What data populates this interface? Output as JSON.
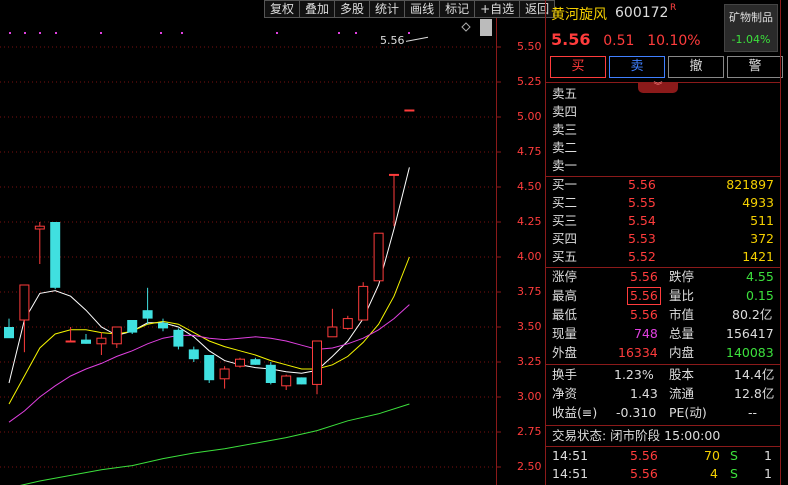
{
  "toolbar": [
    "复权",
    "叠加",
    "多股",
    "统计",
    "画线",
    "标记",
    "+自选",
    "返回"
  ],
  "stock": {
    "name": "黄河旋风",
    "code": "600172",
    "badge": "R",
    "price": "5.56",
    "change": "0.51",
    "pct": "10.10%",
    "sector_name": "矿物制品",
    "sector_chg": "-1.04%"
  },
  "buttons": {
    "buy": "买",
    "sell": "卖",
    "cancel": "撤",
    "alert": "警"
  },
  "expand_icon": "double-chevron-down",
  "sell_orders": [
    {
      "label": "卖五"
    },
    {
      "label": "卖四"
    },
    {
      "label": "卖三"
    },
    {
      "label": "卖二"
    },
    {
      "label": "卖一"
    }
  ],
  "buy_orders": [
    {
      "label": "买一",
      "price": "5.56",
      "vol": "821897"
    },
    {
      "label": "买二",
      "price": "5.55",
      "vol": "4933"
    },
    {
      "label": "买三",
      "price": "5.54",
      "vol": "511"
    },
    {
      "label": "买四",
      "price": "5.53",
      "vol": "372"
    },
    {
      "label": "买五",
      "price": "5.52",
      "vol": "1421"
    }
  ],
  "stats": {
    "zt_l": "涨停",
    "zt_v": "5.56",
    "dt_l": "跌停",
    "dt_v": "4.55",
    "high_l": "最高",
    "high_v": "5.56",
    "lb_l": "量比",
    "lb_v": "0.15",
    "low_l": "最低",
    "low_v": "5.56",
    "mv_l": "市值",
    "mv_v": "80.2亿",
    "cur_l": "现量",
    "cur_v": "748",
    "tot_l": "总量",
    "tot_v": "156417",
    "out_l": "外盘",
    "out_v": "16334",
    "in_l": "内盘",
    "in_v": "140083"
  },
  "fund": {
    "hs_l": "换手",
    "hs_v": "1.23%",
    "gb_l": "股本",
    "gb_v": "14.4亿",
    "jz_l": "净资",
    "jz_v": "1.43",
    "lt_l": "流通",
    "lt_v": "12.8亿",
    "sy_l": "收益(≡)",
    "sy_v": "-0.310",
    "pe_l": "PE(动)",
    "pe_v": "--"
  },
  "status": "交易状态: 闭市阶段 15:00:00",
  "ticks": [
    {
      "time": "14:51",
      "price": "5.56",
      "vol": "70",
      "side": "S",
      "n": "1"
    },
    {
      "time": "14:51",
      "price": "5.56",
      "vol": "4",
      "side": "S",
      "n": "1"
    }
  ],
  "chart": {
    "y_ticks": [
      "5.50",
      "5.25",
      "5.00",
      "4.75",
      "4.50",
      "4.25",
      "4.00",
      "3.75",
      "3.50",
      "3.25",
      "3.00",
      "2.75",
      "2.50"
    ],
    "high_annotation": "5.56",
    "colors": {
      "up": "#ff3c3c",
      "down": "#40e0e0",
      "ma5": "#ffffff",
      "ma10": "#f5f500",
      "ma20": "#e040e0",
      "ma60": "#3ce03c"
    }
  },
  "chart_data": {
    "type": "candlestick",
    "ylim": [
      2.45,
      5.62
    ],
    "candles": [
      {
        "o": 3.5,
        "h": 3.56,
        "l": 3.47,
        "c": 3.42
      },
      {
        "o": 3.55,
        "h": 3.8,
        "l": 3.32,
        "c": 3.8
      },
      {
        "o": 4.2,
        "h": 4.25,
        "l": 3.95,
        "c": 4.22
      },
      {
        "o": 4.25,
        "h": 4.25,
        "l": 3.77,
        "c": 3.78
      },
      {
        "o": 3.4,
        "h": 3.5,
        "l": 3.4,
        "c": 3.4
      },
      {
        "o": 3.41,
        "h": 3.45,
        "l": 3.38,
        "c": 3.38
      },
      {
        "o": 3.38,
        "h": 3.46,
        "l": 3.3,
        "c": 3.42
      },
      {
        "o": 3.38,
        "h": 3.5,
        "l": 3.35,
        "c": 3.5
      },
      {
        "o": 3.55,
        "h": 3.55,
        "l": 3.45,
        "c": 3.46
      },
      {
        "o": 3.62,
        "h": 3.78,
        "l": 3.52,
        "c": 3.56
      },
      {
        "o": 3.53,
        "h": 3.56,
        "l": 3.47,
        "c": 3.49
      },
      {
        "o": 3.48,
        "h": 3.49,
        "l": 3.34,
        "c": 3.36
      },
      {
        "o": 3.34,
        "h": 3.36,
        "l": 3.25,
        "c": 3.27
      },
      {
        "o": 3.3,
        "h": 3.3,
        "l": 3.1,
        "c": 3.12
      },
      {
        "o": 3.13,
        "h": 3.22,
        "l": 3.06,
        "c": 3.2
      },
      {
        "o": 3.22,
        "h": 3.28,
        "l": 3.21,
        "c": 3.27
      },
      {
        "o": 3.27,
        "h": 3.28,
        "l": 3.23,
        "c": 3.23
      },
      {
        "o": 3.23,
        "h": 3.25,
        "l": 3.09,
        "c": 3.1
      },
      {
        "o": 3.08,
        "h": 3.16,
        "l": 3.05,
        "c": 3.15
      },
      {
        "o": 3.14,
        "h": 3.14,
        "l": 3.09,
        "c": 3.09
      },
      {
        "o": 3.09,
        "h": 3.4,
        "l": 3.02,
        "c": 3.4
      },
      {
        "o": 3.43,
        "h": 3.63,
        "l": 3.43,
        "c": 3.5
      },
      {
        "o": 3.49,
        "h": 3.58,
        "l": 3.48,
        "c": 3.56
      },
      {
        "o": 3.55,
        "h": 3.82,
        "l": 3.55,
        "c": 3.79
      },
      {
        "o": 3.83,
        "h": 4.17,
        "l": 3.83,
        "c": 4.17
      },
      {
        "o": 4.59,
        "h": 4.59,
        "l": 4.22,
        "c": 4.59
      },
      {
        "o": 5.05,
        "h": 5.05,
        "l": 5.05,
        "c": 5.05
      }
    ],
    "ma_lines": [
      {
        "name": "MA5",
        "values": [
          [
            0,
            3.1
          ],
          [
            1,
            3.55
          ],
          [
            2,
            3.74
          ],
          [
            3,
            3.76
          ],
          [
            4,
            3.72
          ],
          [
            5,
            3.62
          ],
          [
            6,
            3.5
          ],
          [
            7,
            3.44
          ],
          [
            8,
            3.47
          ],
          [
            9,
            3.53
          ],
          [
            10,
            3.53
          ],
          [
            11,
            3.5
          ],
          [
            12,
            3.43
          ],
          [
            13,
            3.33
          ],
          [
            14,
            3.26
          ],
          [
            15,
            3.23
          ],
          [
            16,
            3.21
          ],
          [
            17,
            3.2
          ],
          [
            18,
            3.18
          ],
          [
            19,
            3.17
          ],
          [
            20,
            3.19
          ],
          [
            21,
            3.29
          ],
          [
            22,
            3.4
          ],
          [
            23,
            3.56
          ],
          [
            24,
            3.8
          ],
          [
            25,
            4.2
          ],
          [
            26,
            4.64
          ]
        ]
      },
      {
        "name": "MA10",
        "values": [
          [
            0,
            2.95
          ],
          [
            1,
            3.15
          ],
          [
            2,
            3.35
          ],
          [
            3,
            3.45
          ],
          [
            4,
            3.48
          ],
          [
            5,
            3.48
          ],
          [
            6,
            3.46
          ],
          [
            7,
            3.45
          ],
          [
            8,
            3.47
          ],
          [
            9,
            3.52
          ],
          [
            10,
            3.54
          ],
          [
            11,
            3.52
          ],
          [
            12,
            3.46
          ],
          [
            13,
            3.4
          ],
          [
            14,
            3.36
          ],
          [
            15,
            3.33
          ],
          [
            16,
            3.3
          ],
          [
            17,
            3.26
          ],
          [
            18,
            3.23
          ],
          [
            19,
            3.2
          ],
          [
            20,
            3.2
          ],
          [
            21,
            3.23
          ],
          [
            22,
            3.29
          ],
          [
            23,
            3.39
          ],
          [
            24,
            3.52
          ],
          [
            25,
            3.72
          ],
          [
            26,
            4.0
          ]
        ]
      },
      {
        "name": "MA20",
        "values": [
          [
            0,
            2.82
          ],
          [
            1,
            2.9
          ],
          [
            2,
            3.0
          ],
          [
            3,
            3.08
          ],
          [
            4,
            3.15
          ],
          [
            5,
            3.2
          ],
          [
            6,
            3.24
          ],
          [
            7,
            3.29
          ],
          [
            8,
            3.33
          ],
          [
            9,
            3.38
          ],
          [
            10,
            3.42
          ],
          [
            11,
            3.44
          ],
          [
            12,
            3.44
          ],
          [
            13,
            3.42
          ],
          [
            14,
            3.41
          ],
          [
            15,
            3.42
          ],
          [
            16,
            3.43
          ],
          [
            17,
            3.42
          ],
          [
            18,
            3.4
          ],
          [
            19,
            3.37
          ],
          [
            20,
            3.34
          ],
          [
            21,
            3.35
          ],
          [
            22,
            3.38
          ],
          [
            23,
            3.42
          ],
          [
            24,
            3.48
          ],
          [
            25,
            3.56
          ],
          [
            26,
            3.66
          ]
        ]
      },
      {
        "name": "MA60",
        "values": [
          [
            0,
            2.35
          ],
          [
            2,
            2.4
          ],
          [
            4,
            2.44
          ],
          [
            6,
            2.48
          ],
          [
            8,
            2.51
          ],
          [
            10,
            2.56
          ],
          [
            12,
            2.6
          ],
          [
            14,
            2.63
          ],
          [
            16,
            2.67
          ],
          [
            18,
            2.71
          ],
          [
            20,
            2.76
          ],
          [
            22,
            2.83
          ],
          [
            24,
            2.88
          ],
          [
            26,
            2.95
          ]
        ]
      }
    ],
    "limit_dots_y": 5.55
  }
}
